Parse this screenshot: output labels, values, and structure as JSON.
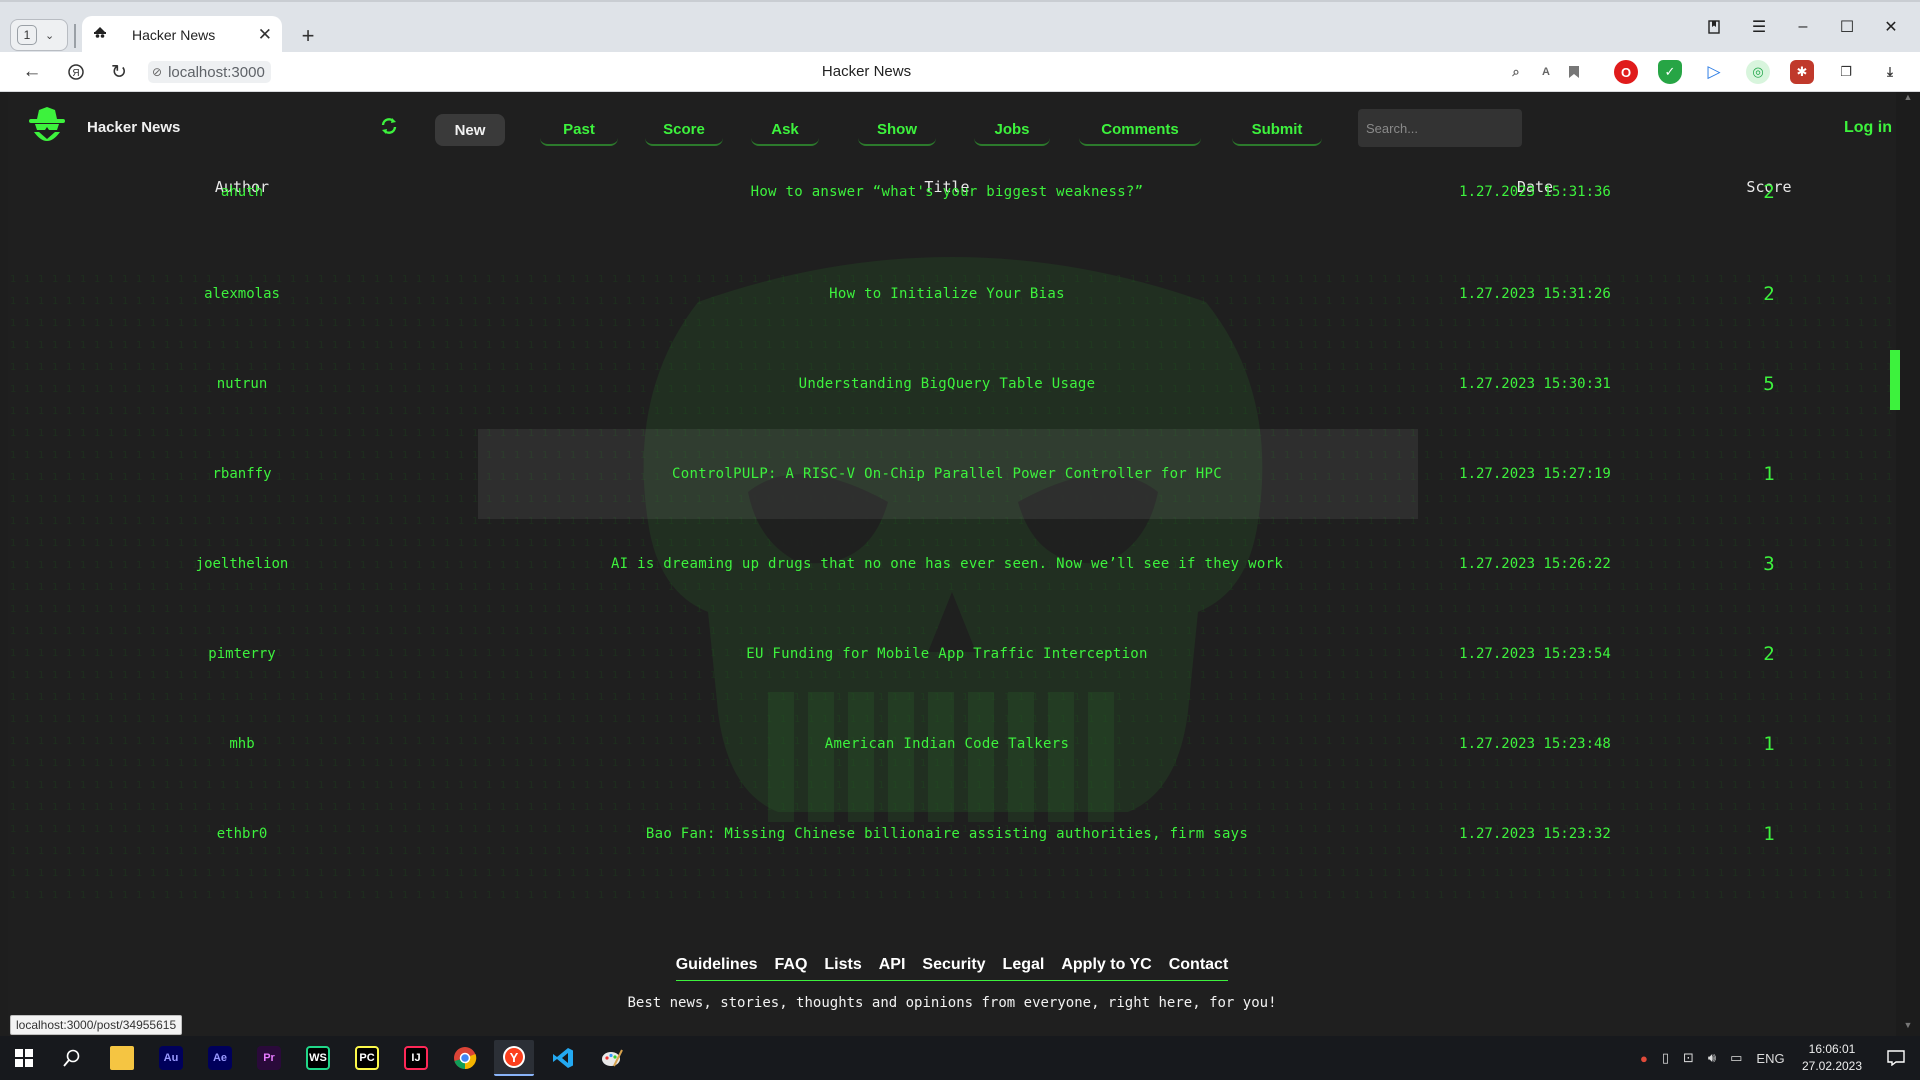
{
  "browser": {
    "tab_count": "1",
    "tab_title": "Hacker News",
    "url": "localhost:3000",
    "page_title": "Hacker News",
    "status_url": "localhost:3000/post/34955615"
  },
  "site": {
    "brand": "Hacker News",
    "nav": [
      "New",
      "Past",
      "Score",
      "Ask",
      "Show",
      "Jobs",
      "Comments",
      "Submit"
    ],
    "active_nav": "New",
    "search_placeholder": "Search...",
    "login": "Log in",
    "accent_color": "#3df23d"
  },
  "table": {
    "headers": [
      "Author",
      "Title",
      "Date",
      "Score"
    ],
    "rows": [
      {
        "author": "ahuth",
        "title": "How to answer “what's your biggest weakness?”",
        "date": "1.27.2023 15:31:36",
        "score": "2"
      },
      {
        "author": "alexmolas",
        "title": "How to Initialize Your Bias",
        "date": "1.27.2023 15:31:26",
        "score": "2"
      },
      {
        "author": "nutrun",
        "title": "Understanding BigQuery Table Usage",
        "date": "1.27.2023 15:30:31",
        "score": "5"
      },
      {
        "author": "rbanffy",
        "title": "ControlPULP: A RISC-V On-Chip Parallel Power Controller for HPC",
        "date": "1.27.2023 15:27:19",
        "score": "1"
      },
      {
        "author": "joelthelion",
        "title": "AI is dreaming up drugs that no one has ever seen. Now we’ll see if they work",
        "date": "1.27.2023 15:26:22",
        "score": "3"
      },
      {
        "author": "pimterry",
        "title": "EU Funding for Mobile App Traffic Interception",
        "date": "1.27.2023 15:23:54",
        "score": "2"
      },
      {
        "author": "mhb",
        "title": "American Indian Code Talkers",
        "date": "1.27.2023 15:23:48",
        "score": "1"
      },
      {
        "author": "ethbr0",
        "title": "Bao Fan: Missing Chinese billionaire assisting authorities, firm says",
        "date": "1.27.2023 15:23:32",
        "score": "1"
      }
    ]
  },
  "footer": {
    "links": [
      "Guidelines",
      "FAQ",
      "Lists",
      "API",
      "Security",
      "Legal",
      "Apply to YC",
      "Contact"
    ],
    "tagline": "Best news, stories, thoughts and opinions from everyone, right here, for you!"
  },
  "taskbar": {
    "apps": [
      "Au",
      "Ae",
      "Pr",
      "WS",
      "PC",
      "IJ"
    ],
    "lang": "ENG",
    "time": "16:06:01",
    "date": "27.02.2023"
  }
}
